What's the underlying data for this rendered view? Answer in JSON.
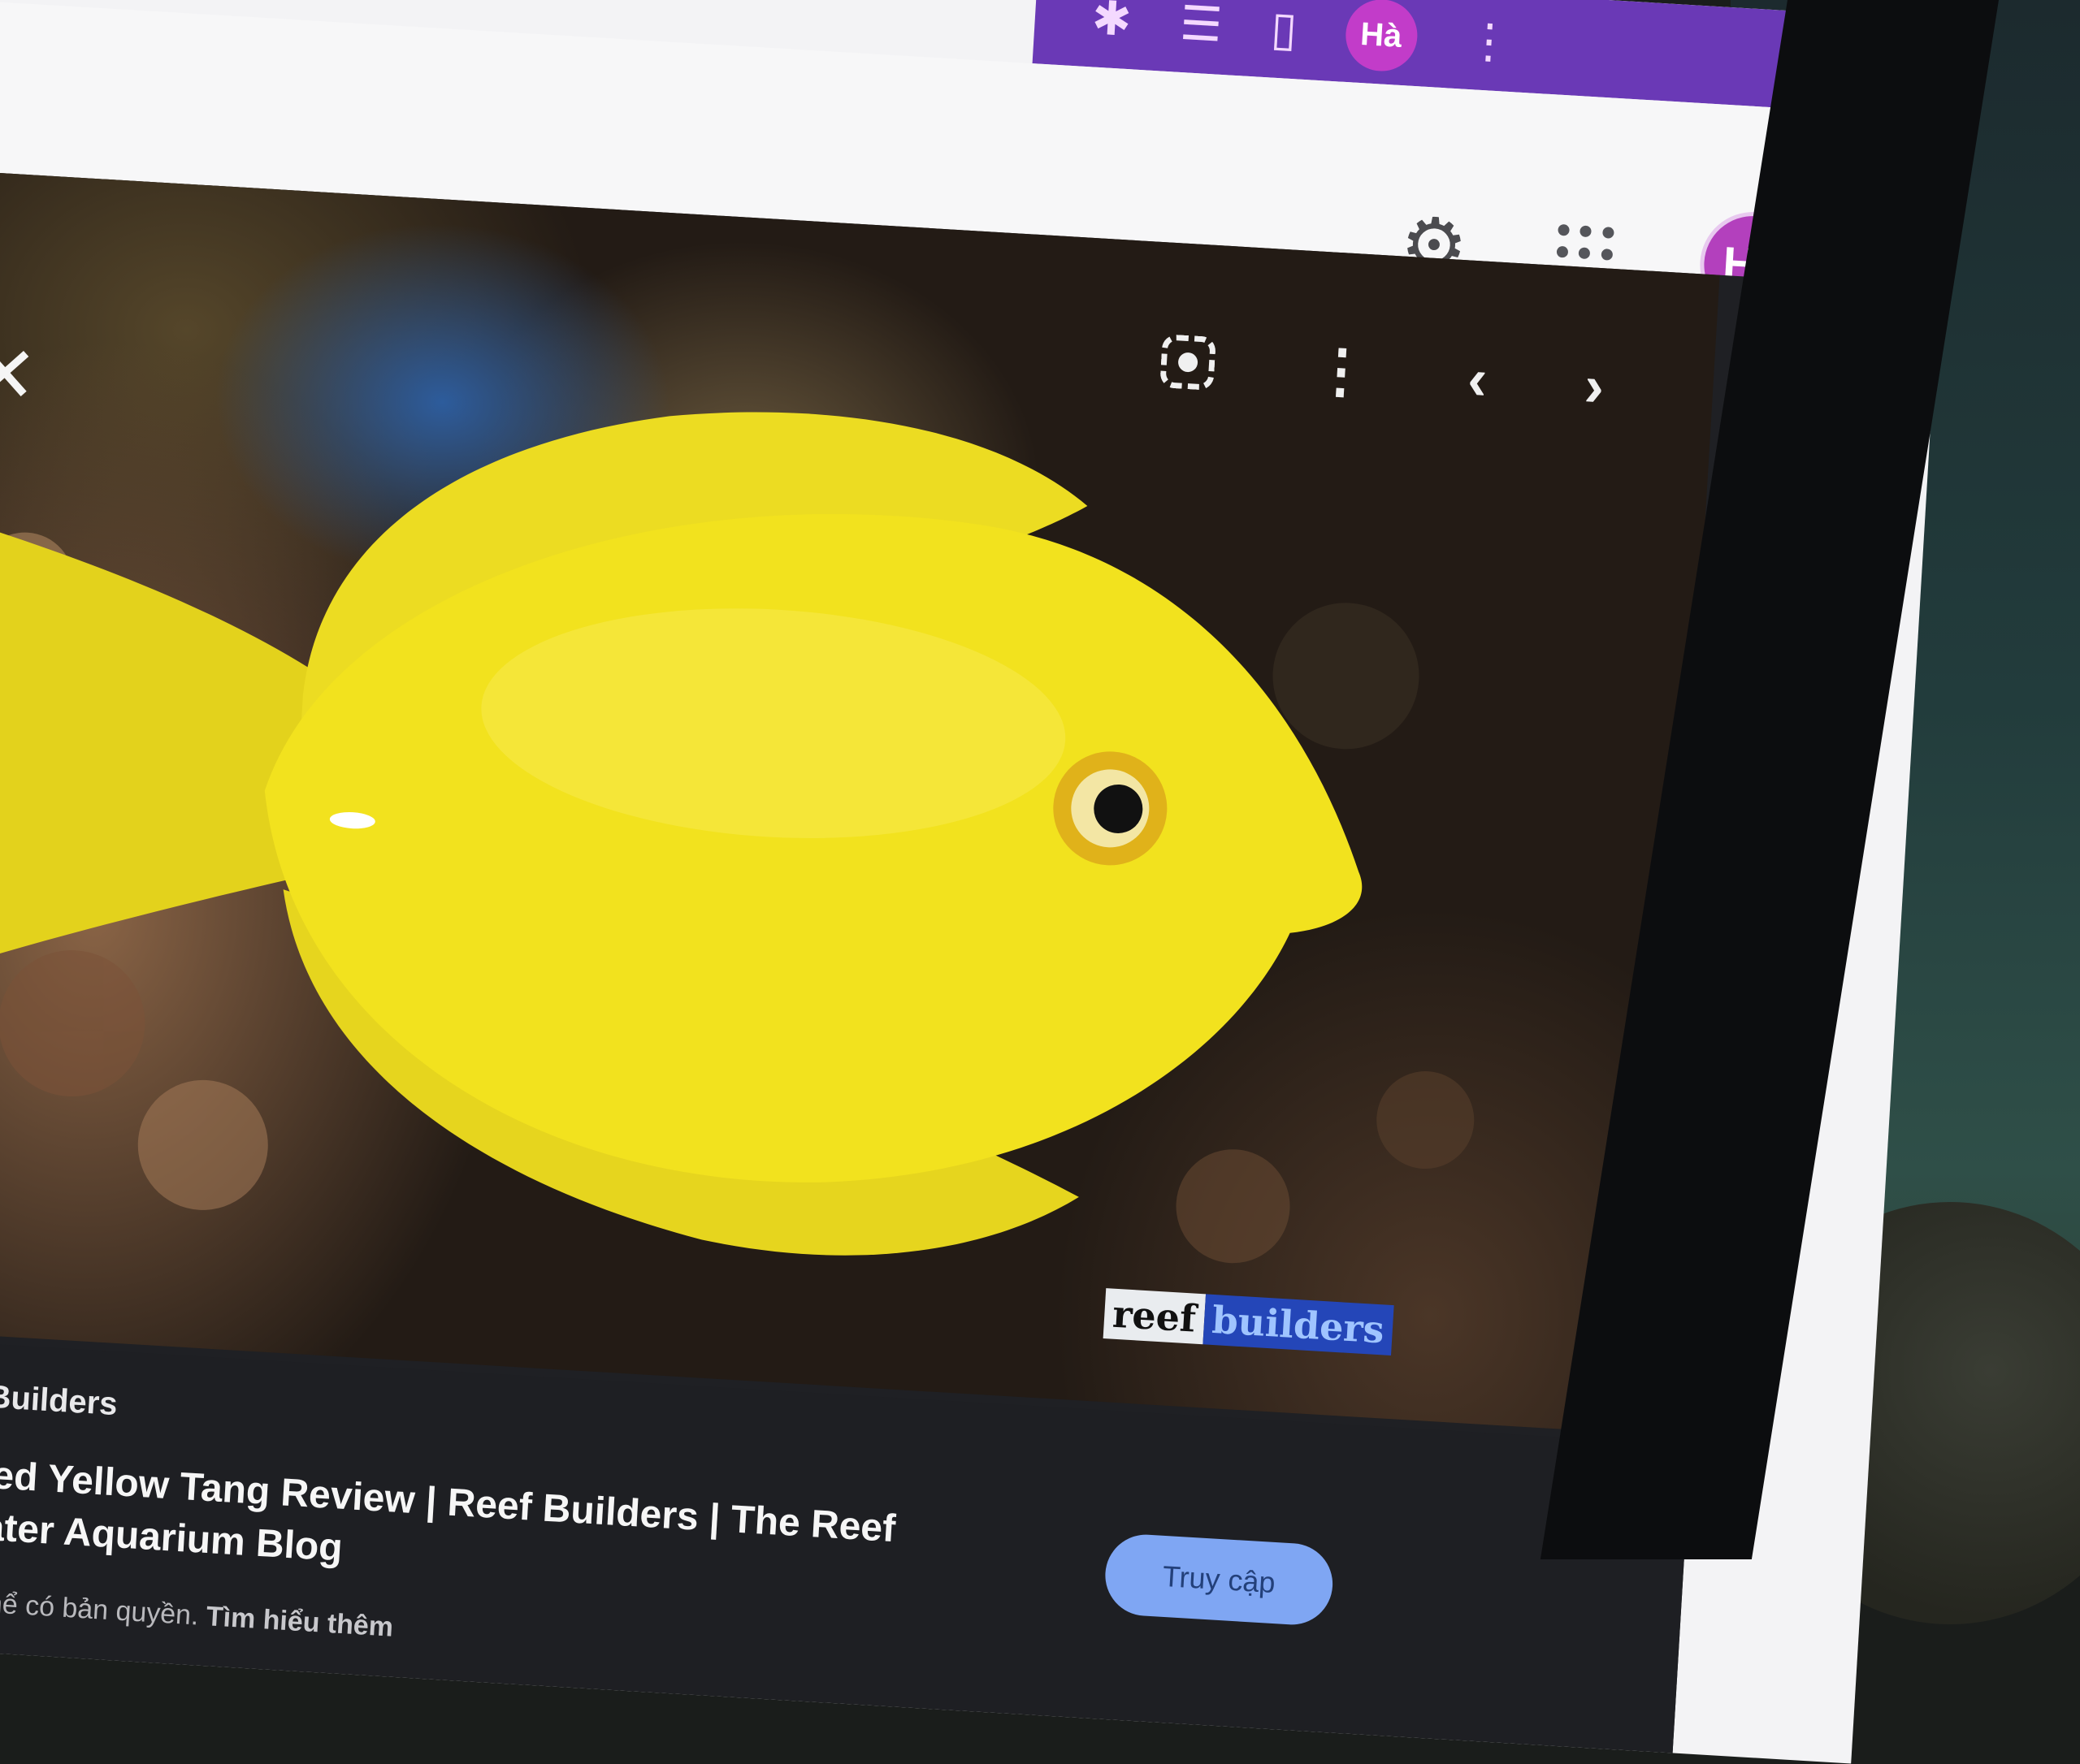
{
  "extension_bar": {
    "icons": [
      "puzzle-icon",
      "bookmark-icon",
      "sidepanel-icon"
    ],
    "avatar_initials": "Hà"
  },
  "top_bar": {
    "icons": [
      "gear-icon",
      "apps-grid-icon"
    ],
    "account_avatar_initials": "Hà"
  },
  "viewer": {
    "photo_subject": "yellow tang fish",
    "watermark": {
      "part1": "reef",
      "part2": "builders"
    }
  },
  "result": {
    "source_name": "Reef Builders",
    "title_line1": "aptive Bred Yellow Tang Review | Reef Builders | The Reef",
    "title_line2": "nd Saltwater Aquarium Blog",
    "copyright_text": "nh ảnh có thể có bản quyền.",
    "learn_more": "Tìm hiểu thêm",
    "visit_button": "Truy cập"
  },
  "colors": {
    "extension_bar": "#6a39b6",
    "avatar": "#b340bd",
    "fish": "#f2e21e",
    "visit_button": "#7fa6f3"
  }
}
